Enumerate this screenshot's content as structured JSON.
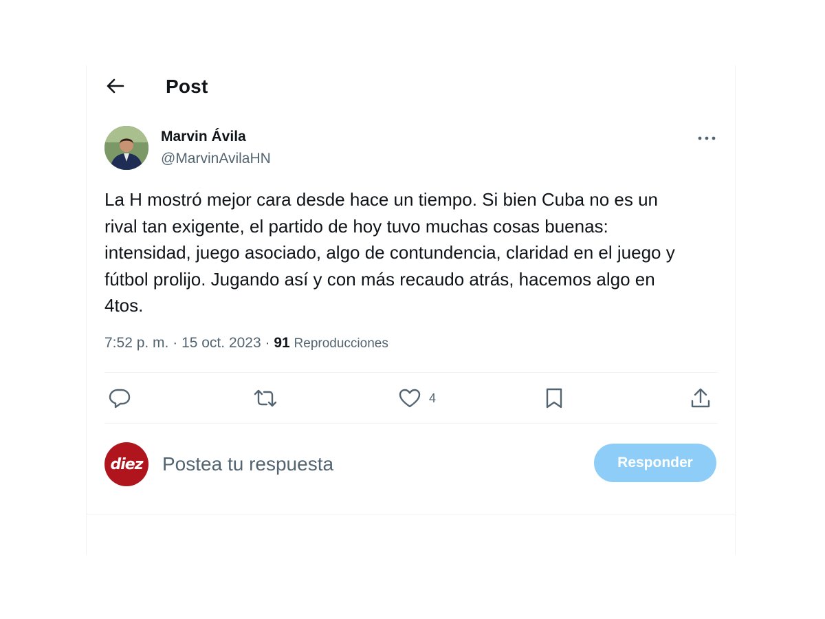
{
  "header": {
    "title": "Post",
    "back_icon": "arrow-left-icon"
  },
  "author": {
    "name": "Marvin Ávila",
    "handle": "@MarvinAvilaHN",
    "more_icon": "more-horizontal-icon"
  },
  "post": {
    "text": "La H mostró mejor cara desde hace un tiempo. Si bien Cuba no es un\nrival tan exigente, el partido de hoy tuvo muchas cosas buenas:\nintensidad, juego asociado, algo de contundencia, claridad en el juego y\nfútbol prolijo. Jugando así y con más recaudo atrás, hacemos algo en\n4tos.",
    "time": "7:52 p. m.",
    "date": "15 oct. 2023",
    "views_count": "91",
    "views_label": "Reproducciones"
  },
  "actions": {
    "reply_icon": "comment-icon",
    "repost_icon": "repost-icon",
    "like_icon": "heart-icon",
    "like_count": "4",
    "bookmark_icon": "bookmark-icon",
    "share_icon": "share-icon"
  },
  "reply": {
    "avatar_text": "diez",
    "placeholder": "Postea tu respuesta",
    "button_label": "Responder"
  },
  "colors": {
    "accent_disabled": "#8ecdf7",
    "secondary_text": "#536471",
    "brand_red": "#b0151d"
  }
}
